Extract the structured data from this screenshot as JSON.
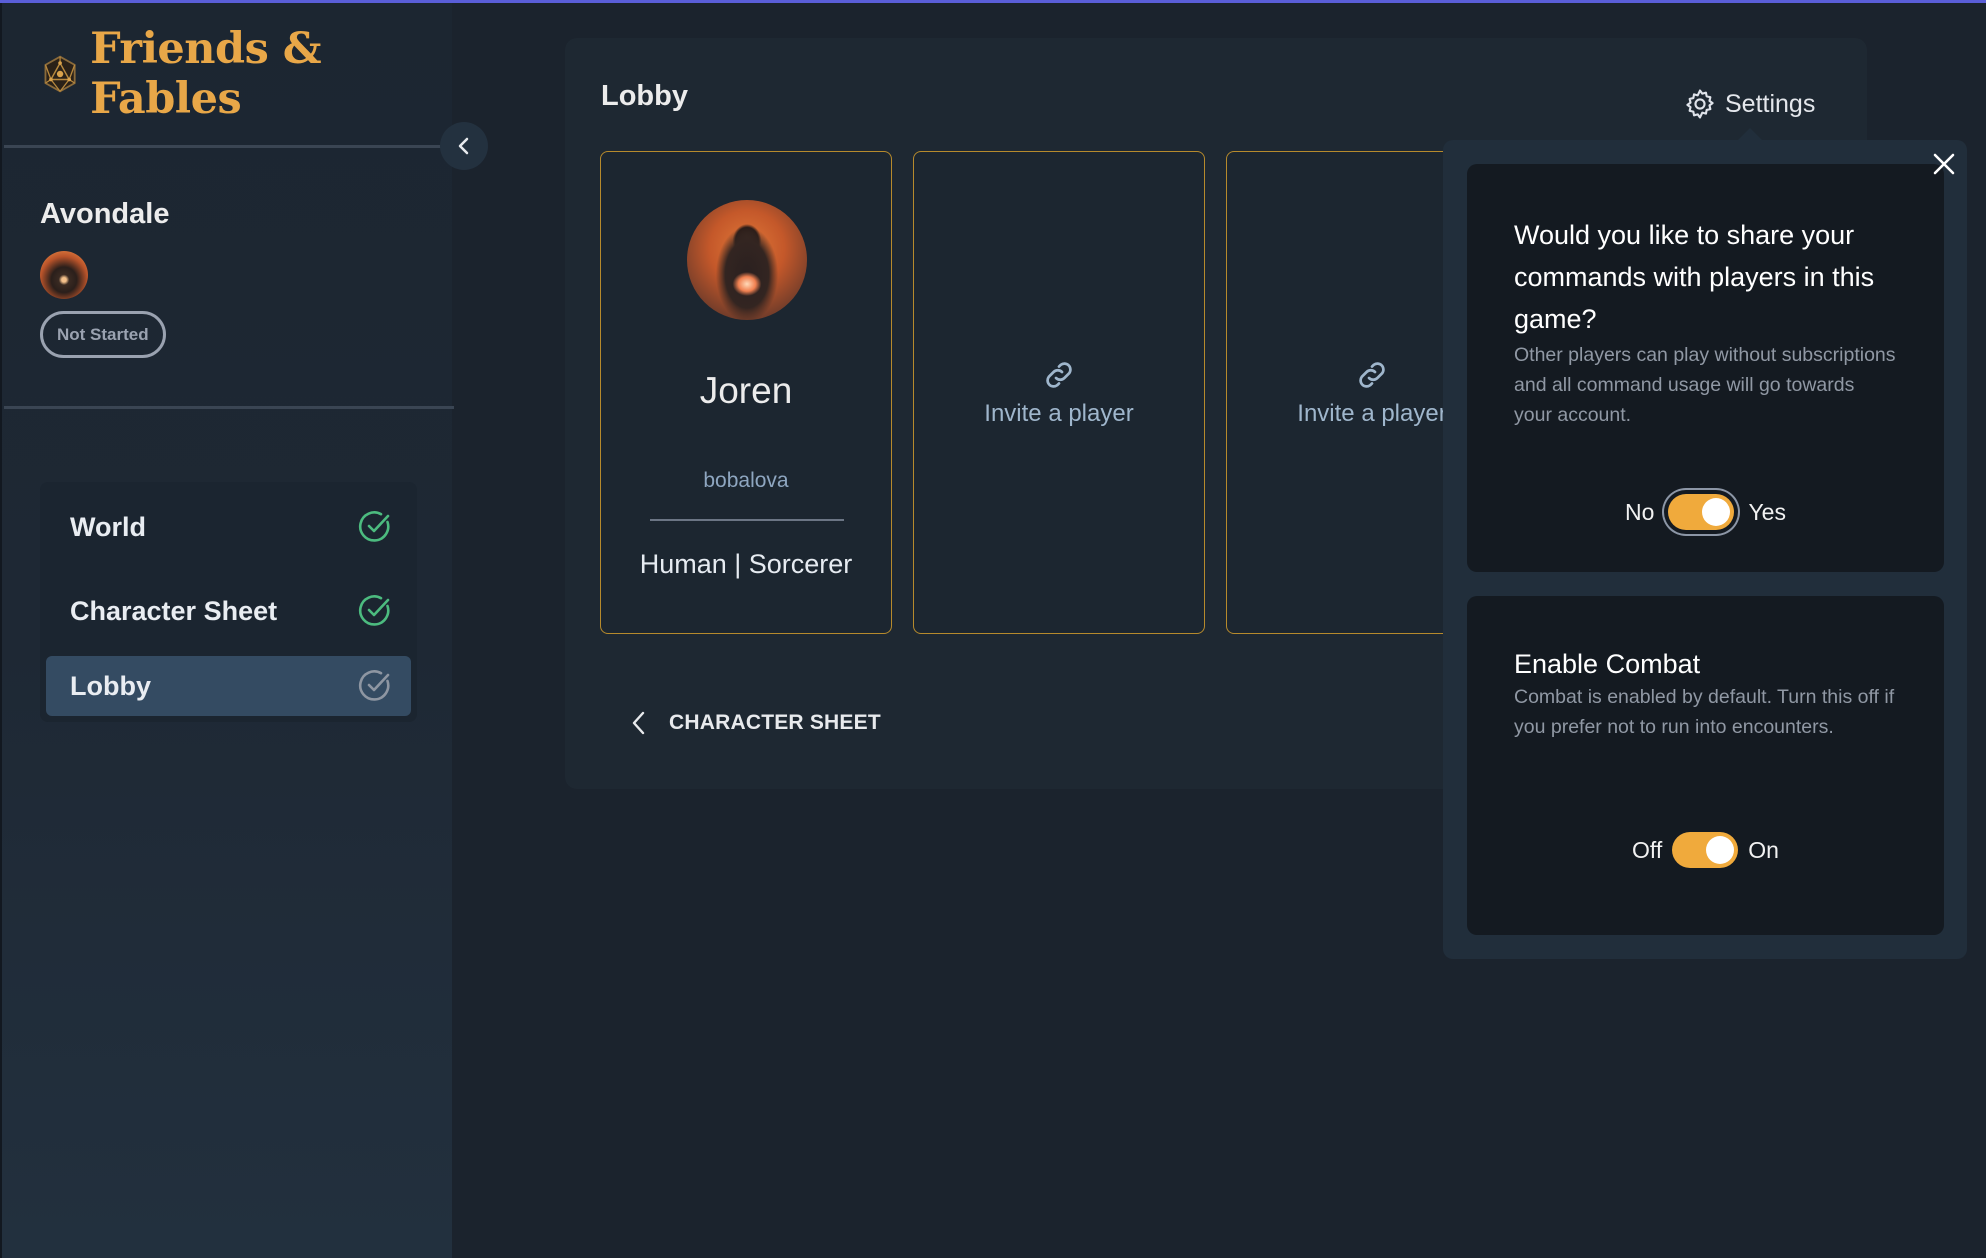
{
  "app": {
    "name": "Friends & Fables",
    "logo_icon": "d20-dice-icon",
    "accent_color": "#e8a748",
    "topline_color": "#5a5ed8"
  },
  "sidebar": {
    "collapse_icon": "chevron-left-icon",
    "game_title": "Avondale",
    "status": "Not Started",
    "nav": [
      {
        "label": "World",
        "completed": true,
        "active": false,
        "icon": "check-circle-icon",
        "icon_color": "#4cbb7f"
      },
      {
        "label": "Character Sheet",
        "completed": true,
        "active": false,
        "icon": "check-circle-icon",
        "icon_color": "#4cbb7f"
      },
      {
        "label": "Lobby",
        "completed": false,
        "active": true,
        "icon": "check-circle-icon",
        "icon_color": "#8e96a2"
      }
    ]
  },
  "main": {
    "title": "Lobby",
    "settings_label": "Settings",
    "cards": [
      {
        "type": "player",
        "name": "Joren",
        "username": "bobalova",
        "info": "Human | Sorcerer"
      },
      {
        "type": "invite",
        "label": "Invite a player",
        "icon": "link-icon"
      },
      {
        "type": "invite",
        "label": "Invite a player",
        "icon": "link-icon"
      }
    ],
    "back_label": "CHARACTER SHEET"
  },
  "settings_popover": {
    "close_icon": "close-icon",
    "settings": [
      {
        "title": "Would you like to share your commands with players in this game?",
        "description": "Other players can play without subscriptions and all command usage will go towards your account.",
        "off_label": "No",
        "on_label": "Yes",
        "enabled": true
      },
      {
        "title": "Enable Combat",
        "description": "Combat is enabled by default. Turn this off if you prefer not to run into encounters.",
        "off_label": "Off",
        "on_label": "On",
        "enabled": true
      }
    ],
    "toggle_color": "#f0aa3c"
  }
}
